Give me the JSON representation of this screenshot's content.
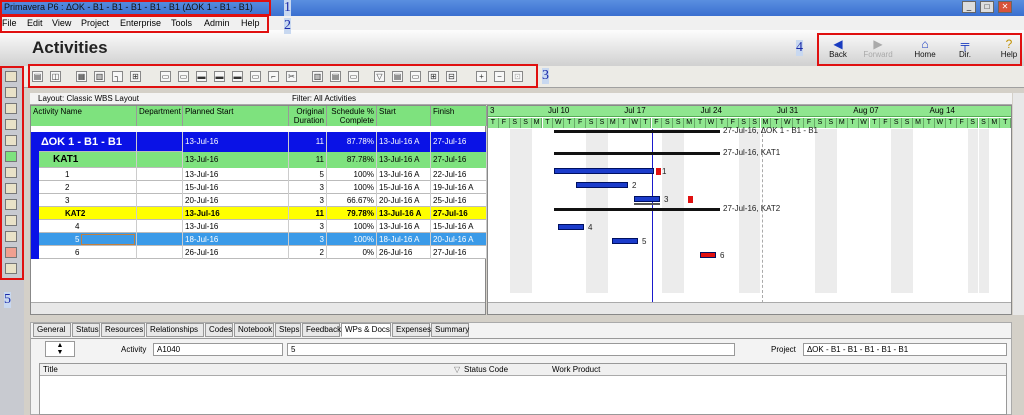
{
  "window": {
    "title": "Primavera P6 : ΔΟΚ - B1 - B1 - B1 - B1 - B1 (ΔΟΚ 1 - B1 - B1)"
  },
  "menu": [
    "File",
    "Edit",
    "View",
    "Project",
    "Enterprise",
    "Tools",
    "Admin",
    "Help"
  ],
  "page": {
    "title": "Activities"
  },
  "nav": {
    "back": "Back",
    "forward": "Forward",
    "home": "Home",
    "dir": "Dir.",
    "help": "Help"
  },
  "annotations": {
    "n1": "1",
    "n2": "2",
    "n3": "3",
    "n4": "4",
    "n5": "5"
  },
  "table": {
    "layout_label": "Layout: Classic WBS Layout",
    "filter_label": "Filter: All Activities",
    "headers": {
      "name": "Activity Name",
      "dept": "Department",
      "planned": "Planned Start",
      "duration": "Original Duration",
      "schedule": "Schedule % Complete",
      "start": "Start",
      "finish": "Finish"
    },
    "rows": [
      {
        "name": "ΔΟΚ 1 - B1 - B1",
        "dept": "",
        "planned": "13-Jul-16",
        "duration": "11",
        "schedule": "87.78%",
        "start": "13-Jul-16 A",
        "finish": "27-Jul-16"
      },
      {
        "name": "KAT1",
        "dept": "",
        "planned": "13-Jul-16",
        "duration": "11",
        "schedule": "87.78%",
        "start": "13-Jul-16 A",
        "finish": "27-Jul-16"
      },
      {
        "name": "1",
        "dept": "",
        "planned": "13-Jul-16",
        "duration": "5",
        "schedule": "100%",
        "start": "13-Jul-16 A",
        "finish": "22-Jul-16"
      },
      {
        "name": "2",
        "dept": "",
        "planned": "15-Jul-16",
        "duration": "3",
        "schedule": "100%",
        "start": "15-Jul-16 A",
        "finish": "19-Jul-16 A"
      },
      {
        "name": "3",
        "dept": "",
        "planned": "20-Jul-16",
        "duration": "3",
        "schedule": "66.67%",
        "start": "20-Jul-16 A",
        "finish": "25-Jul-16"
      },
      {
        "name": "KAT2",
        "dept": "",
        "planned": "13-Jul-16",
        "duration": "11",
        "schedule": "79.78%",
        "start": "13-Jul-16 A",
        "finish": "27-Jul-16"
      },
      {
        "name": "4",
        "dept": "",
        "planned": "13-Jul-16",
        "duration": "3",
        "schedule": "100%",
        "start": "13-Jul-16 A",
        "finish": "15-Jul-16 A"
      },
      {
        "name": "5",
        "dept": "",
        "planned": "18-Jul-16",
        "duration": "3",
        "schedule": "100%",
        "start": "18-Jul-16 A",
        "finish": "20-Jul-16 A"
      },
      {
        "name": "6",
        "dept": "",
        "planned": "26-Jul-16",
        "duration": "2",
        "schedule": "0%",
        "start": "26-Jul-16",
        "finish": "27-Jul-16"
      }
    ]
  },
  "gantt": {
    "first_month_label": "3",
    "weeks": [
      "Jul 10",
      "Jul 17",
      "Jul 24",
      "Jul 31",
      "Aug 07",
      "Aug 14"
    ],
    "day_letters": [
      "T",
      "F",
      "S",
      "S",
      "M",
      "T",
      "W"
    ],
    "labels": {
      "wbs": "27-Jul-16, ΔΟΚ 1 - B1 - B1",
      "kat1": "27-Jul-16, KAT1",
      "kat2": "27-Jul-16, KAT2",
      "a1": "1",
      "a2": "2",
      "a3": "3",
      "a4": "4",
      "a5": "5",
      "a6": "6"
    }
  },
  "detail": {
    "tabs": [
      "General",
      "Status",
      "Resources",
      "Relationships",
      "Codes",
      "Notebook",
      "Steps",
      "Feedback",
      "WPs & Docs",
      "Expenses",
      "Summary"
    ],
    "activity_label": "Activity",
    "activity_id": "A1040",
    "activity_name": "5",
    "project_label": "Project",
    "project_value": "ΔΟΚ - B1 - B1 - B1 - B1 - B1",
    "cols": {
      "title": "Title",
      "status_code": "Status Code",
      "work_product": "Work Product"
    }
  },
  "colors": {
    "wbs_blue": "#0a12e6",
    "kat_green": "#7ee27e",
    "kat2_yellow": "#ffff00",
    "selected": "#3a9ae8",
    "bar_blue": "#1b3ccb",
    "bar_red": "#e01010"
  }
}
